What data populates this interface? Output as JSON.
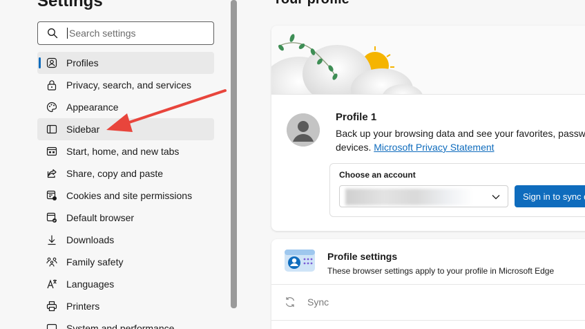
{
  "sidebar": {
    "title": "Settings",
    "search": {
      "placeholder": "Search settings",
      "value": ""
    },
    "items": [
      {
        "label": "Profiles",
        "icon": "profile-icon",
        "active": true
      },
      {
        "label": "Privacy, search, and services",
        "icon": "lock-icon"
      },
      {
        "label": "Appearance",
        "icon": "palette-icon"
      },
      {
        "label": "Sidebar",
        "icon": "sidebar-icon",
        "highlighted": true
      },
      {
        "label": "Start, home, and new tabs",
        "icon": "home-tabs-icon"
      },
      {
        "label": "Share, copy and paste",
        "icon": "share-icon"
      },
      {
        "label": "Cookies and site permissions",
        "icon": "cookies-icon"
      },
      {
        "label": "Default browser",
        "icon": "browser-icon"
      },
      {
        "label": "Downloads",
        "icon": "download-icon"
      },
      {
        "label": "Family safety",
        "icon": "family-icon"
      },
      {
        "label": "Languages",
        "icon": "language-icon"
      },
      {
        "label": "Printers",
        "icon": "printer-icon"
      },
      {
        "label": "System and performance",
        "icon": "system-icon"
      }
    ]
  },
  "main": {
    "title": "Your profile",
    "profile": {
      "name": "Profile 1",
      "description_line1": "Back up your browsing data and see your favorites, passwo",
      "description_line2": "devices.",
      "privacy_link": "Microsoft Privacy Statement"
    },
    "account": {
      "label": "Choose an account",
      "value": "",
      "sign_in_button": "Sign in to sync d"
    },
    "profile_settings": {
      "title": "Profile settings",
      "description": "These browser settings apply to your profile in Microsoft Edge",
      "sync_label": "Sync"
    }
  },
  "colors": {
    "accent": "#0f6cbd",
    "annotation_arrow": "#e8453c"
  }
}
